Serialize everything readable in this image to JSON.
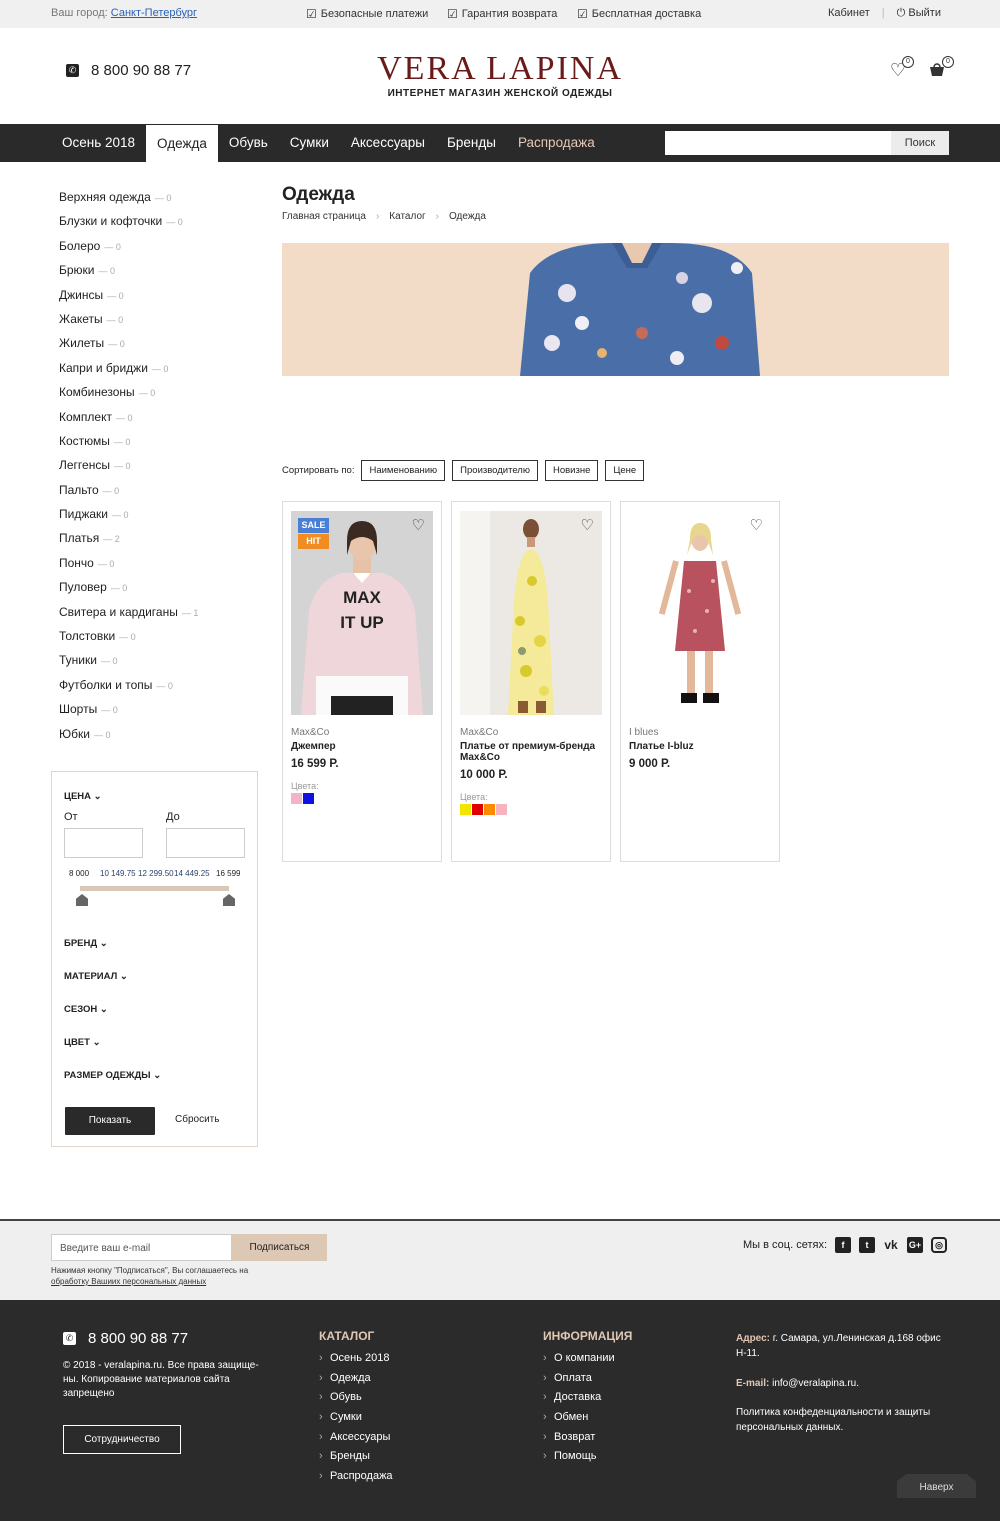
{
  "topbar": {
    "city_label": "Ваш город:",
    "city": "Санкт-Петербург",
    "features": [
      "Безопасные платежи",
      "Гарантия возврата",
      "Бесплатная доставка"
    ],
    "cabinet": "Кабинет",
    "logout": "Выйти"
  },
  "header": {
    "phone": "8 800 90 88 77",
    "logo": "VERA LAPINA",
    "tagline": "ИНТЕРНЕТ МАГАЗИН ЖЕНСКОЙ ОДЕЖДЫ",
    "wishlist_count": "0",
    "cart_count": "0"
  },
  "nav": {
    "items": [
      "Осень 2018",
      "Одежда",
      "Обувь",
      "Сумки",
      "Аксессуары",
      "Бренды",
      "Распродажа"
    ],
    "search_button": "Поиск"
  },
  "categories": [
    {
      "name": "Верхняя одежда",
      "count": "— 0"
    },
    {
      "name": "Блузки и кофточки",
      "count": "— 0"
    },
    {
      "name": "Болеро",
      "count": "— 0"
    },
    {
      "name": "Брюки",
      "count": "— 0"
    },
    {
      "name": "Джинсы",
      "count": "— 0"
    },
    {
      "name": "Жакеты",
      "count": "— 0"
    },
    {
      "name": "Жилеты",
      "count": "— 0"
    },
    {
      "name": "Капри и бриджи",
      "count": "— 0"
    },
    {
      "name": "Комбинезоны",
      "count": "— 0"
    },
    {
      "name": "Комплект",
      "count": "— 0"
    },
    {
      "name": "Костюмы",
      "count": "— 0"
    },
    {
      "name": "Леггенсы",
      "count": "— 0"
    },
    {
      "name": "Пальто",
      "count": "— 0"
    },
    {
      "name": "Пиджаки",
      "count": "— 0"
    },
    {
      "name": "Платья",
      "count": "— 2"
    },
    {
      "name": "Пончо",
      "count": "— 0"
    },
    {
      "name": "Пуловер",
      "count": "— 0"
    },
    {
      "name": "Свитера и кардиганы",
      "count": "— 1"
    },
    {
      "name": "Толстовки",
      "count": "— 0"
    },
    {
      "name": "Туники",
      "count": "— 0"
    },
    {
      "name": "Футболки и топы",
      "count": "— 0"
    },
    {
      "name": "Шорты",
      "count": "— 0"
    },
    {
      "name": "Юбки",
      "count": "— 0"
    }
  ],
  "filter": {
    "price_label": "ЦЕНА",
    "from_label": "От",
    "to_label": "До",
    "ticks": [
      "8 000",
      "10 149.75",
      "12 299.50",
      "14 449.25",
      "16 599"
    ],
    "groups": [
      "БРЕНД",
      "МАТЕРИАЛ",
      "СЕЗОН",
      "ЦВЕТ",
      "РАЗМЕР ОДЕЖДЫ"
    ],
    "show": "Показать",
    "reset": "Сбросить"
  },
  "main": {
    "title": "Одежда",
    "breadcrumbs": [
      "Главная страница",
      "Каталог",
      "Одежда"
    ],
    "sort_label": "Сортировать по:",
    "sort_options": [
      "Наименованию",
      "Производителю",
      "Новизне",
      "Цене"
    ]
  },
  "products": [
    {
      "brand": "Max&Co",
      "name": "Джемпер",
      "price": "16 599 Р.",
      "colors_label": "Цвета:",
      "colors": [
        "#f3b3c8",
        "#1010e0"
      ],
      "badges": [
        "SALE",
        "HIT"
      ],
      "shirt_text": "MAX IT UP"
    },
    {
      "brand": "Max&Co",
      "name": "Платье от премиум-бренда Max&Co",
      "price": "10 000 Р.",
      "colors_label": "Цвета:",
      "colors": [
        "#f2e600",
        "#e00000",
        "#ff8a00",
        "#f5b3c0"
      ]
    },
    {
      "brand": "I blues",
      "name": "Платье I-bluz",
      "price": "9 000 Р."
    }
  ],
  "subscribe": {
    "placeholder": "Введите ваш e-mail",
    "button": "Подписаться",
    "note_line1": "Нажимая кнопку \"Подписаться\", Вы соглашаетесь на",
    "note_link": "обработку Вашиих персональных данных",
    "social_label": "Мы в соц. сетях:"
  },
  "footer": {
    "phone": "8 800 90 88 77",
    "copyright": "© 2018 - veralapina.ru. Все права защище-ны. Копирование материалов сайта запрещено",
    "coop": "Сотрудничество",
    "catalog_title": "КАТАЛОГ",
    "catalog": [
      "Осень 2018",
      "Одежда",
      "Обувь",
      "Сумки",
      "Аксессуары",
      "Бренды",
      "Распродажа"
    ],
    "info_title": "ИНФОРМАЦИЯ",
    "info": [
      "О компании",
      "Оплата",
      "Доставка",
      "Обмен",
      "Возврат",
      "Помощь"
    ],
    "address_label": "Адрес:",
    "address": "г. Самара, ул.Ленинская д.168 офис Н-11.",
    "email_label": "E-mail:",
    "email": "info@veralapina.ru.",
    "policy": "Политика конфеденциальности и защиты персональных данных.",
    "to_top": "Наверх"
  }
}
